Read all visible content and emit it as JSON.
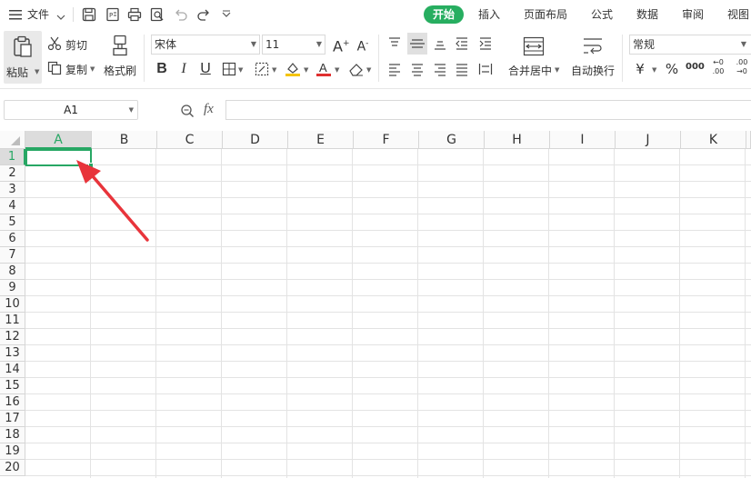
{
  "menubar": {
    "file_label": "文件",
    "tabs": [
      {
        "label": "开始",
        "active": true
      },
      {
        "label": "插入",
        "active": false
      },
      {
        "label": "页面布局",
        "active": false
      },
      {
        "label": "公式",
        "active": false
      },
      {
        "label": "数据",
        "active": false
      },
      {
        "label": "审阅",
        "active": false
      },
      {
        "label": "视图",
        "active": false
      }
    ],
    "accent_color": "#27ae60"
  },
  "ribbon": {
    "paste_label": "粘贴",
    "cut_label": "剪切",
    "copy_label": "复制",
    "format_painter_label": "格式刷",
    "font_name": "宋体",
    "font_size": "11",
    "merge_center_label": "合并居中",
    "wrap_text_label": "自动换行",
    "number_format": "常规",
    "currency_symbol": "¥",
    "percent_symbol": "%",
    "thousands_symbol": "000",
    "increase_decimal": "←0\n.00",
    "decrease_decimal": ".00\n→0",
    "bold": "B",
    "italic": "I",
    "underline": "U",
    "font_color": "#e03030",
    "fill_color": "#f5c400"
  },
  "formula_bar": {
    "name_box": "A1",
    "fx_label": "fx",
    "formula": ""
  },
  "grid": {
    "columns": [
      "A",
      "B",
      "C",
      "D",
      "E",
      "F",
      "G",
      "H",
      "I",
      "J",
      "K"
    ],
    "rows": [
      "1",
      "2",
      "3",
      "4",
      "5",
      "6",
      "7",
      "8",
      "9",
      "10",
      "11",
      "12",
      "13",
      "14",
      "15",
      "16",
      "17",
      "18",
      "19",
      "20"
    ],
    "selected_cell": "A1",
    "selection_color": "#27a764"
  },
  "annotation": {
    "arrow_color": "#e8343b"
  }
}
